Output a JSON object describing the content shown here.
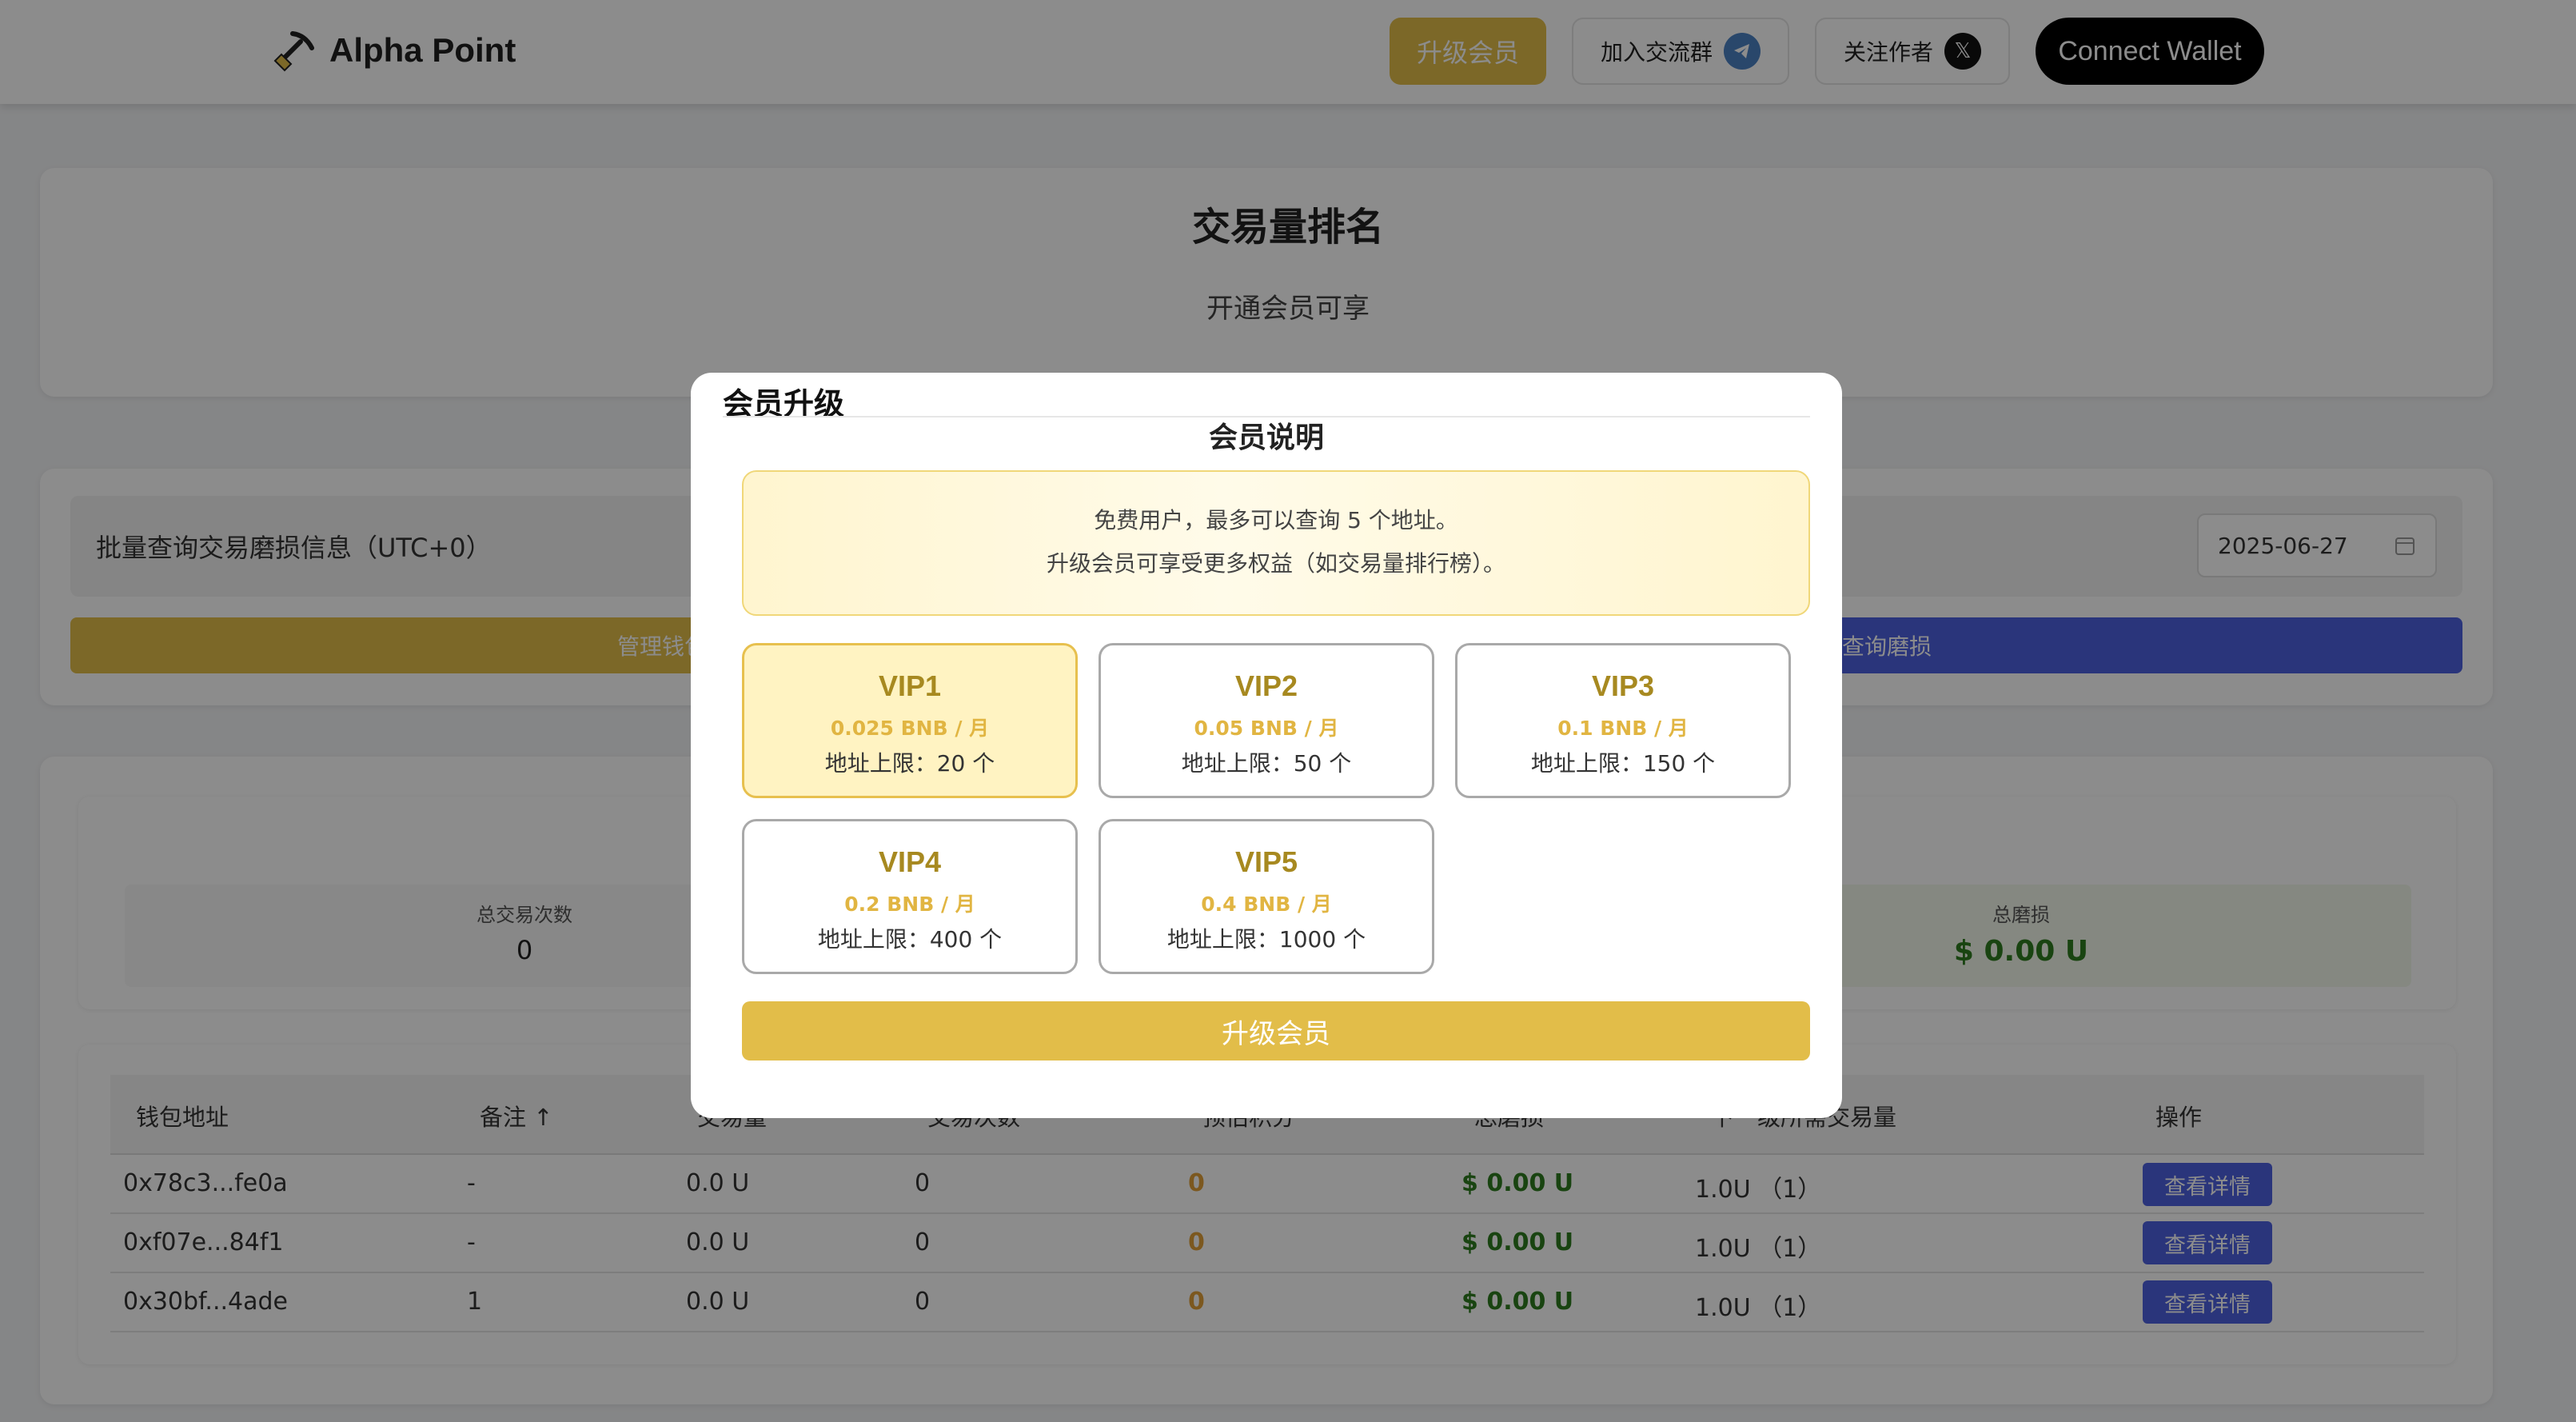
{
  "header": {
    "app_name": "Alpha Point",
    "upgrade_label": "升级会员",
    "join_group_label": "加入交流群",
    "follow_author_label": "关注作者",
    "connect_wallet_label": "Connect Wallet"
  },
  "ranking": {
    "title": "交易量排名",
    "subtitle": "开通会员可享"
  },
  "query": {
    "label": "批量查询交易磨损信息（UTC+0）",
    "date_value": "2025-06-27",
    "manage_wallet_label": "管理钱包",
    "query_label": "查询磨损"
  },
  "stats": {
    "total_tx_label": "总交易次数",
    "total_tx_value": "0",
    "total_loss_label": "总磨损",
    "total_loss_value": "$ 0.00 U"
  },
  "table": {
    "headers": {
      "wallet": "钱包地址",
      "note": "备注 ↑",
      "volume": "交易量",
      "count": "交易次数",
      "points": "预估积分",
      "loss": "总磨损",
      "next": "下一级所需交易量",
      "action": "操作"
    },
    "rows": [
      {
        "wallet": "0x78c3...fe0a",
        "note": "-",
        "volume": "0.0 U",
        "count": "0",
        "points": "0",
        "loss": "$ 0.00 U",
        "next": "1.0U （1）",
        "action": "查看详情"
      },
      {
        "wallet": "0xf07e...84f1",
        "note": "-",
        "volume": "0.0 U",
        "count": "0",
        "points": "0",
        "loss": "$ 0.00 U",
        "next": "1.0U （1）",
        "action": "查看详情"
      },
      {
        "wallet": "0x30bf...4ade",
        "note": "1",
        "volume": "0.0 U",
        "count": "0",
        "points": "0",
        "loss": "$ 0.00 U",
        "next": "1.0U （1）",
        "action": "查看详情"
      }
    ]
  },
  "modal": {
    "title": "会员升级",
    "subtitle": "会员说明",
    "notice_line1": "免费用户，最多可以查询 5 个地址。",
    "notice_line2": "升级会员可享受更多权益（如交易量排行榜）。",
    "plans": [
      {
        "name": "VIP1",
        "price": "0.025 BNB / 月",
        "limit": "地址上限：20 个"
      },
      {
        "name": "VIP2",
        "price": "0.05 BNB / 月",
        "limit": "地址上限：50 个"
      },
      {
        "name": "VIP3",
        "price": "0.1 BNB / 月",
        "limit": "地址上限：150 个"
      },
      {
        "name": "VIP4",
        "price": "0.2 BNB / 月",
        "limit": "地址上限：400 个"
      },
      {
        "name": "VIP5",
        "price": "0.4 BNB / 月",
        "limit": "地址上限：1000 个"
      }
    ],
    "selected_plan": "VIP1",
    "upgrade_button": "升级会员"
  },
  "colors": {
    "gold": "#e2bd49",
    "blue": "#4e62e0",
    "green": "#2f7d1f",
    "orange": "#e2a13a",
    "telegram": "#4c82c3"
  }
}
